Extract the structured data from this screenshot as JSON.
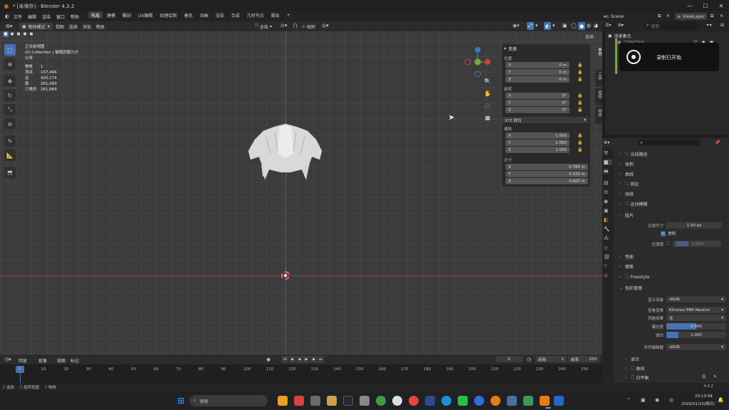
{
  "title": "* [未保存] - Blender 4.3.2",
  "menu": [
    "文件",
    "编辑",
    "渲染",
    "窗口",
    "帮助"
  ],
  "workspaces": [
    "布局",
    "建模",
    "雕刻",
    "UV编辑",
    "纹理绘制",
    "着色",
    "动画",
    "渲染",
    "合成",
    "几何节点",
    "脚本"
  ],
  "active_workspace": "布局",
  "viewport_header": {
    "editor_mode": "物体模式",
    "menus": [
      "视图",
      "选择",
      "添加",
      "物体"
    ],
    "transform_orientation": "全局",
    "snap": "吸附",
    "options": "选项"
  },
  "viewport_stats": {
    "view_name": "正交前视图",
    "collection": "(0) Collection | 皱褶衣服九分",
    "units": "公米",
    "rows": [
      {
        "label": "物体",
        "value": "1"
      },
      {
        "label": "顶点",
        "value": "157,466"
      },
      {
        "label": "边",
        "value": "420,174"
      },
      {
        "label": "面",
        "value": "261,689"
      },
      {
        "label": "三角形",
        "value": "261,689"
      }
    ]
  },
  "npanel": {
    "header": "变换",
    "location_label": "位置",
    "location": [
      {
        "axis": "X",
        "value": "0 m"
      },
      {
        "axis": "Y",
        "value": "0 m"
      },
      {
        "axis": "Z",
        "value": "0 m"
      }
    ],
    "rotation_label": "旋转",
    "rotation": [
      {
        "axis": "X",
        "value": "0°"
      },
      {
        "axis": "Y",
        "value": "0°"
      },
      {
        "axis": "Z",
        "value": "0°"
      }
    ],
    "rotation_mode": "XYZ 欧拉",
    "scale_label": "缩放",
    "scale": [
      {
        "axis": "X",
        "value": "1.000"
      },
      {
        "axis": "Y",
        "value": "1.000"
      },
      {
        "axis": "Z",
        "value": "1.000"
      }
    ],
    "dimensions_label": "尺寸",
    "dimensions": [
      {
        "axis": "X",
        "value": "0.784 m"
      },
      {
        "axis": "Y",
        "value": "0.333 m"
      },
      {
        "axis": "Z",
        "value": "0.605 m"
      }
    ],
    "tabs": [
      "条目",
      "工具",
      "视图",
      "物体"
    ]
  },
  "outliner": {
    "scene": "Scene",
    "view_layer": "ViewLayer",
    "search_placeholder": "搜索",
    "root": "场景集合",
    "item": "Collection",
    "notification": "录制已开始"
  },
  "properties": {
    "search_placeholder": "",
    "sections": [
      {
        "label": "光线路径",
        "open": false
      },
      {
        "label": "体积",
        "open": false
      },
      {
        "label": "曲线",
        "open": false
      },
      {
        "label": "简化",
        "open": false
      },
      {
        "label": "烘焙",
        "open": false
      },
      {
        "label": "运动模糊",
        "open": false
      },
      {
        "label": "胶片",
        "open": true
      }
    ],
    "film": {
      "filter_size_label": "过滤尺寸",
      "filter_size": "1.50 px",
      "transparent_label": "透明",
      "transparent_glass_label": "过渡值",
      "transparent_glass": "0.00%"
    },
    "sections2": [
      {
        "label": "性能",
        "open": false
      },
      {
        "label": "蜡笔",
        "open": false
      },
      {
        "label": "Freestyle",
        "open": false
      },
      {
        "label": "色彩管理",
        "open": true
      }
    ],
    "color": {
      "display_label": "显示设备",
      "display": "sRGB",
      "view_label": "查看变换",
      "view": "Khronos PBR Neutral",
      "look_label": "风格效果",
      "look": "无",
      "exposure_label": "曝光度",
      "exposure": "0.000",
      "gamma_label": "伽玛",
      "gamma": "1.000",
      "sequencer_label": "序列编辑器",
      "sequencer": "sRGB"
    },
    "sections3": [
      {
        "label": "显示",
        "open": false
      },
      {
        "label": "曲线",
        "open": false
      },
      {
        "label": "白平衡",
        "open": false
      }
    ],
    "version": "4.3.2"
  },
  "timeline": {
    "menus": [
      "回放",
      "抠像",
      "视图",
      "标记"
    ],
    "current_frame": "0",
    "start_label": "起始",
    "start": "1",
    "end_label": "结束",
    "end": "250",
    "ticks": [
      "0",
      "10",
      "20",
      "30",
      "40",
      "50",
      "60",
      "70",
      "80",
      "90",
      "100",
      "110",
      "120",
      "130",
      "140",
      "150",
      "160",
      "170",
      "180",
      "190",
      "200",
      "210",
      "220",
      "230",
      "240",
      "250"
    ]
  },
  "status": [
    "选择",
    "旋转视图",
    "物体"
  ],
  "taskbar": {
    "search_placeholder": "搜索",
    "time": "23:13:58",
    "date": "2025/01/15(周日)"
  },
  "colors": {
    "accent": "#4772b3",
    "x_axis": "#c64545",
    "y_axis": "#78a93a",
    "z_axis": "#3a77c6"
  }
}
